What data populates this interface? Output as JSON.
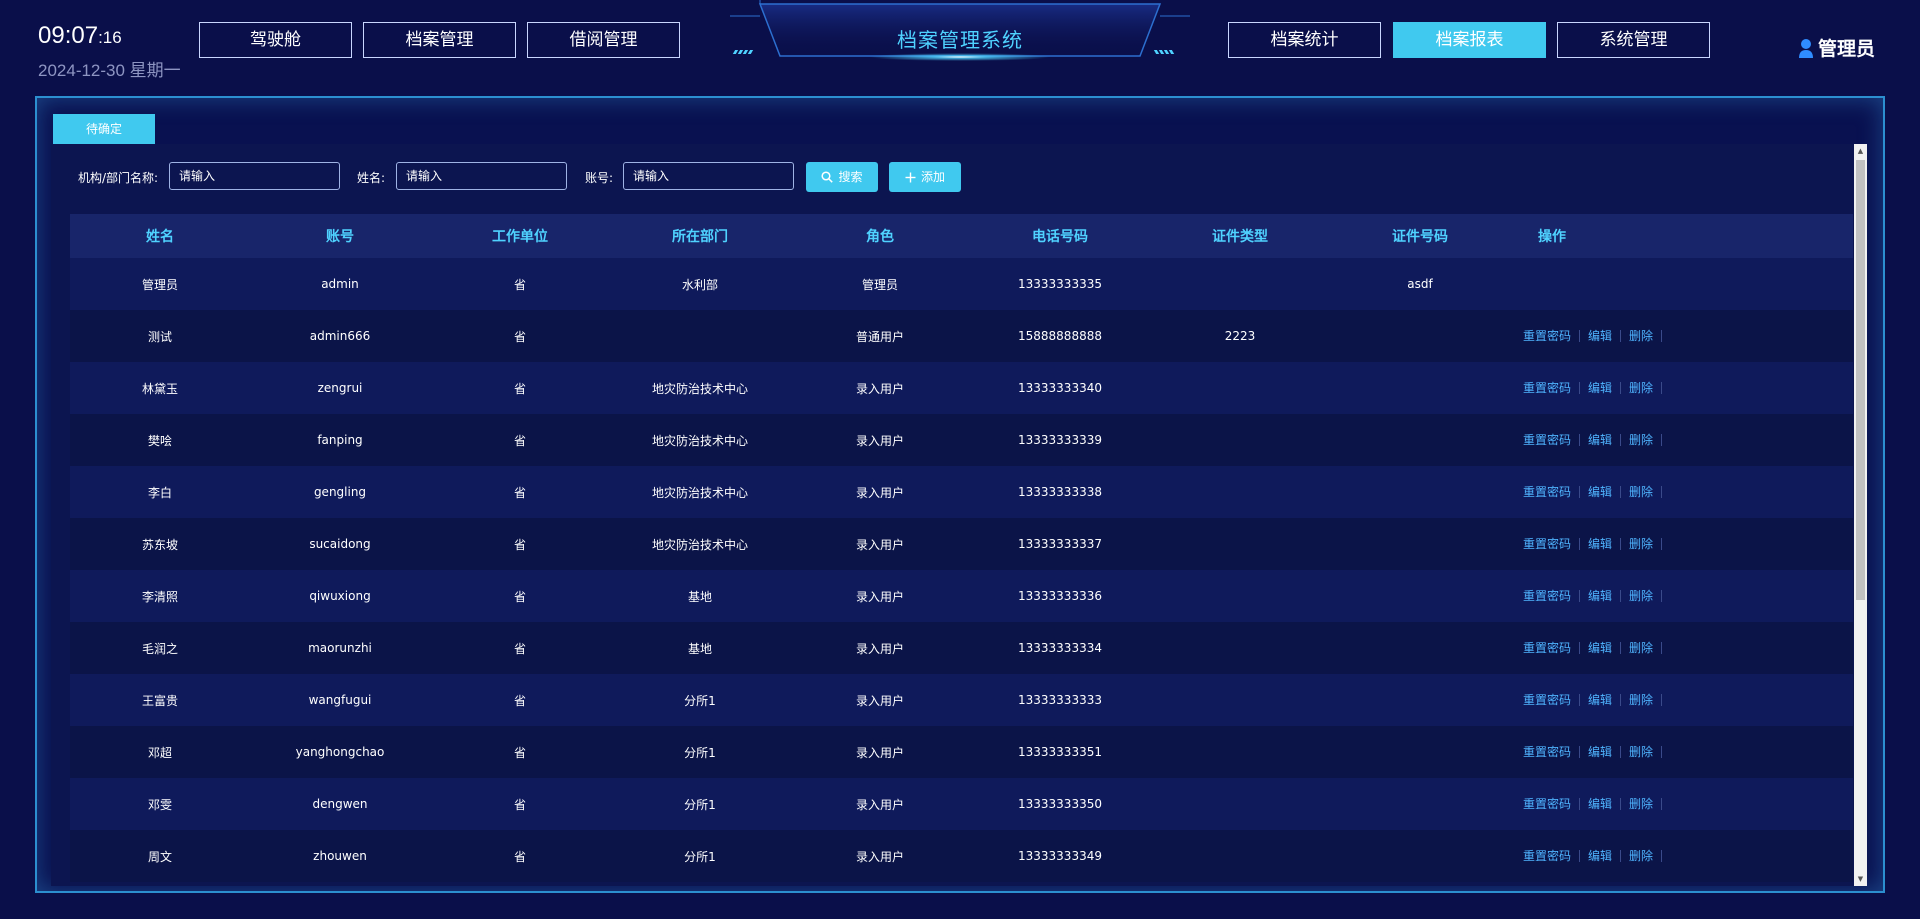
{
  "header": {
    "time_main": "09:07",
    "time_sec": ":16",
    "date": "2024-12-30 星期一",
    "title": "档案管理系统",
    "nav_left": [
      "驾驶舱",
      "档案管理",
      "借阅管理"
    ],
    "nav_right": [
      "档案统计",
      "档案报表",
      "系统管理"
    ],
    "active_nav": "档案报表",
    "user": "管理员"
  },
  "tab": {
    "label": "待确定"
  },
  "filters": {
    "org_label": "机构/部门名称:",
    "org_placeholder": "请输入",
    "name_label": "姓名:",
    "name_placeholder": "请输入",
    "account_label": "账号:",
    "account_placeholder": "请输入",
    "search_label": "搜索",
    "add_label": "添加"
  },
  "table": {
    "columns": [
      "姓名",
      "账号",
      "工作单位",
      "所在部门",
      "角色",
      "电话号码",
      "证件类型",
      "证件号码",
      "操作"
    ],
    "op_labels": [
      "重置密码",
      "编辑",
      "删除"
    ],
    "rows": [
      {
        "name": "管理员",
        "account": "admin",
        "unit": "省",
        "dept": "水利部",
        "role": "管理员",
        "phone": "13333333335",
        "id_type": "",
        "id_no": "asdf"
      },
      {
        "name": "测试",
        "account": "admin666",
        "unit": "省",
        "dept": "",
        "role": "普通用户",
        "phone": "15888888888",
        "id_type": "2223",
        "id_no": ""
      },
      {
        "name": "林黛玉",
        "account": "zengrui",
        "unit": "省",
        "dept": "地灾防治技术中心",
        "role": "录入用户",
        "phone": "13333333340",
        "id_type": "",
        "id_no": ""
      },
      {
        "name": "樊哙",
        "account": "fanping",
        "unit": "省",
        "dept": "地灾防治技术中心",
        "role": "录入用户",
        "phone": "13333333339",
        "id_type": "",
        "id_no": ""
      },
      {
        "name": "李白",
        "account": "gengling",
        "unit": "省",
        "dept": "地灾防治技术中心",
        "role": "录入用户",
        "phone": "13333333338",
        "id_type": "",
        "id_no": ""
      },
      {
        "name": "苏东坡",
        "account": "sucaidong",
        "unit": "省",
        "dept": "地灾防治技术中心",
        "role": "录入用户",
        "phone": "13333333337",
        "id_type": "",
        "id_no": ""
      },
      {
        "name": "李清照",
        "account": "qiwuxiong",
        "unit": "省",
        "dept": "基地",
        "role": "录入用户",
        "phone": "13333333336",
        "id_type": "",
        "id_no": ""
      },
      {
        "name": "毛润之",
        "account": "maorunzhi",
        "unit": "省",
        "dept": "基地",
        "role": "录入用户",
        "phone": "13333333334",
        "id_type": "",
        "id_no": ""
      },
      {
        "name": "王富贵",
        "account": "wangfugui",
        "unit": "省",
        "dept": "分所1",
        "role": "录入用户",
        "phone": "13333333333",
        "id_type": "",
        "id_no": ""
      },
      {
        "name": "邓超",
        "account": "yanghongchao",
        "unit": "省",
        "dept": "分所1",
        "role": "录入用户",
        "phone": "13333333351",
        "id_type": "",
        "id_no": ""
      },
      {
        "name": "邓雯",
        "account": "dengwen",
        "unit": "省",
        "dept": "分所1",
        "role": "录入用户",
        "phone": "13333333350",
        "id_type": "",
        "id_no": ""
      },
      {
        "name": "周文",
        "account": "zhouwen",
        "unit": "省",
        "dept": "分所1",
        "role": "录入用户",
        "phone": "13333333349",
        "id_type": "",
        "id_no": ""
      }
    ]
  },
  "colors": {
    "accent": "#40c9ef",
    "background": "#0a0f4a",
    "link": "#4fb4ff",
    "title": "#4fd2ff"
  }
}
